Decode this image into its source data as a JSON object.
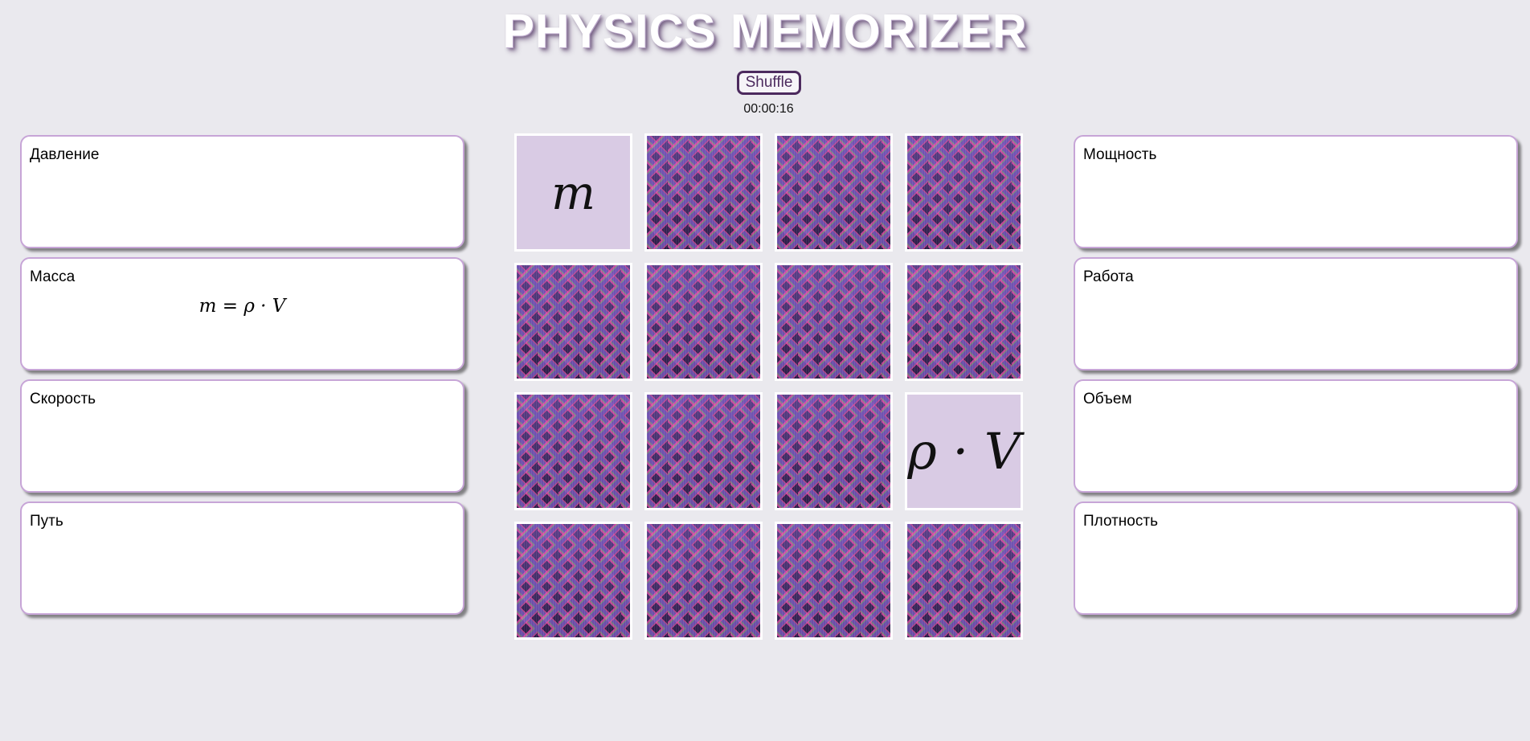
{
  "header": {
    "title": "PHYSICS MEMORIZER",
    "shuffle_label": "Shuffle",
    "timer": "00:00:16"
  },
  "left_slots": [
    {
      "label": "Давление",
      "formula": ""
    },
    {
      "label": "Масса",
      "formula": "m = ρ · V"
    },
    {
      "label": "Скорость",
      "formula": ""
    },
    {
      "label": "Путь",
      "formula": ""
    }
  ],
  "right_slots": [
    {
      "label": "Мощность",
      "formula": ""
    },
    {
      "label": "Работа",
      "formula": ""
    },
    {
      "label": "Объем",
      "formula": ""
    },
    {
      "label": "Плотность",
      "formula": ""
    }
  ],
  "cards": [
    {
      "revealed": true,
      "content": "m"
    },
    {
      "revealed": false,
      "content": ""
    },
    {
      "revealed": false,
      "content": ""
    },
    {
      "revealed": false,
      "content": ""
    },
    {
      "revealed": false,
      "content": ""
    },
    {
      "revealed": false,
      "content": ""
    },
    {
      "revealed": false,
      "content": ""
    },
    {
      "revealed": false,
      "content": ""
    },
    {
      "revealed": false,
      "content": ""
    },
    {
      "revealed": false,
      "content": ""
    },
    {
      "revealed": false,
      "content": ""
    },
    {
      "revealed": true,
      "content": "ρ · V"
    },
    {
      "revealed": false,
      "content": ""
    },
    {
      "revealed": false,
      "content": ""
    },
    {
      "revealed": false,
      "content": ""
    },
    {
      "revealed": false,
      "content": ""
    }
  ],
  "colors": {
    "background": "#eae9ee",
    "accent": "#4c2a5e",
    "slot_border": "#c7a5d7",
    "card_face": "#d9cbe4"
  }
}
